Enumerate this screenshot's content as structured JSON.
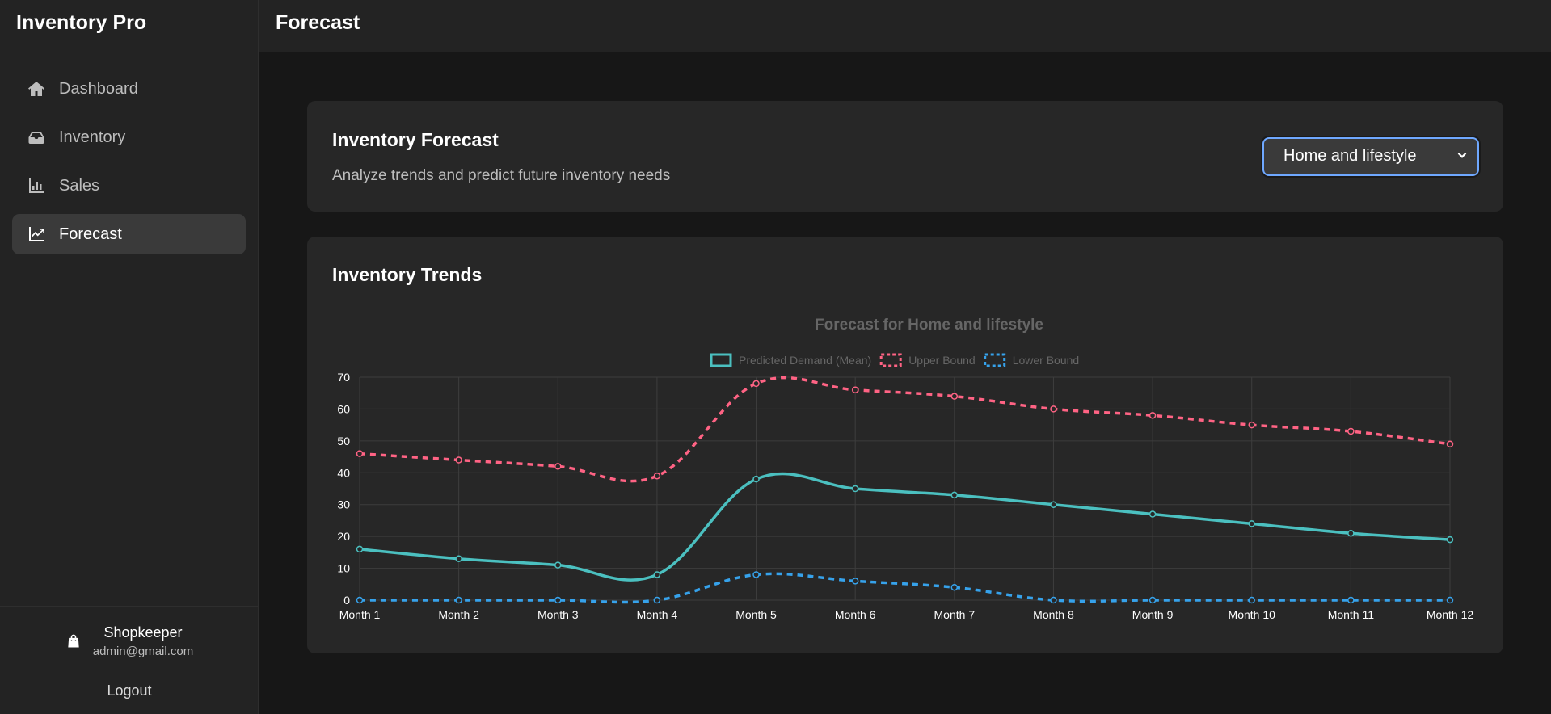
{
  "app": {
    "title": "Inventory Pro"
  },
  "header": {
    "title": "Forecast"
  },
  "sidebar": {
    "items": [
      {
        "label": "Dashboard",
        "icon": "home-icon",
        "active": false
      },
      {
        "label": "Inventory",
        "icon": "inbox-icon",
        "active": false
      },
      {
        "label": "Sales",
        "icon": "bar-chart-icon",
        "active": false
      },
      {
        "label": "Forecast",
        "icon": "trend-chart-icon",
        "active": true
      }
    ]
  },
  "user": {
    "name": "Shopkeeper",
    "email": "admin@gmail.com",
    "logout_label": "Logout",
    "icon": "shopping-bag-icon"
  },
  "forecast_card": {
    "title": "Inventory Forecast",
    "subtitle": "Analyze trends and predict future inventory needs",
    "category_select": {
      "value": "Home and lifestyle"
    }
  },
  "trends_card": {
    "title": "Inventory Trends"
  },
  "colors": {
    "mean": "#4bc0c0",
    "upper": "#ff6384",
    "lower": "#36a2eb",
    "accent_focus": "#6fa8ff"
  },
  "chart_data": {
    "type": "line",
    "title": "Forecast for Home and lifestyle",
    "xlabel": "",
    "ylabel": "",
    "ylim": [
      0,
      70
    ],
    "yticks": [
      0,
      10,
      20,
      30,
      40,
      50,
      60,
      70
    ],
    "grid": true,
    "legend": "top-center",
    "categories": [
      "Month 1",
      "Month 2",
      "Month 3",
      "Month 4",
      "Month 5",
      "Month 6",
      "Month 7",
      "Month 8",
      "Month 9",
      "Month 10",
      "Month 11",
      "Month 12"
    ],
    "series": [
      {
        "name": "Predicted Demand (Mean)",
        "color": "#4bc0c0",
        "dashed": false,
        "values": [
          16,
          13,
          11,
          8,
          38,
          35,
          33,
          30,
          27,
          24,
          21,
          19
        ]
      },
      {
        "name": "Upper Bound",
        "color": "#ff6384",
        "dashed": true,
        "values": [
          46,
          44,
          42,
          39,
          68,
          66,
          64,
          60,
          58,
          55,
          53,
          49
        ]
      },
      {
        "name": "Lower Bound",
        "color": "#36a2eb",
        "dashed": true,
        "values": [
          0,
          0,
          0,
          0,
          8,
          6,
          4,
          0,
          0,
          0,
          0,
          0
        ]
      }
    ]
  }
}
